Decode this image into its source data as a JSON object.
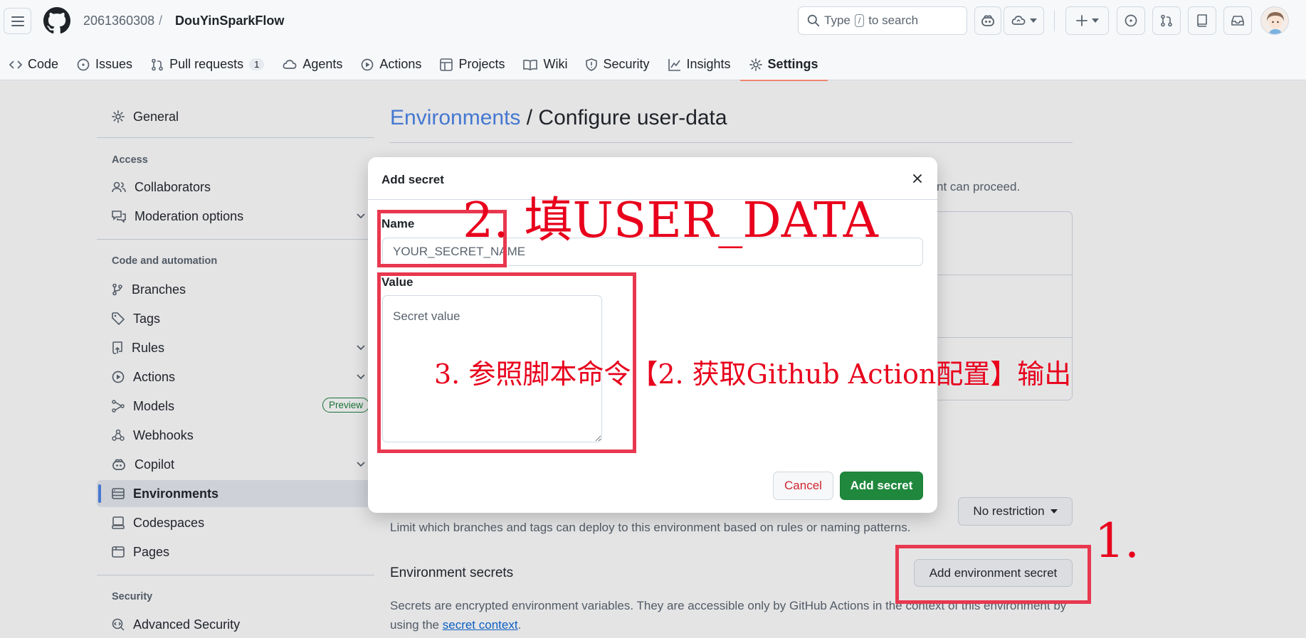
{
  "header": {
    "owner": "2061360308",
    "separator": "/",
    "repo": "DouYinSparkFlow",
    "search": {
      "prefix": "Type",
      "key": "/",
      "suffix": "to search"
    }
  },
  "tabs": [
    {
      "label": "Code",
      "icon": "code-icon"
    },
    {
      "label": "Issues",
      "icon": "issue-icon"
    },
    {
      "label": "Pull requests",
      "icon": "pull-request-icon",
      "count": "1"
    },
    {
      "label": "Agents",
      "icon": "agent-icon"
    },
    {
      "label": "Actions",
      "icon": "play-icon"
    },
    {
      "label": "Projects",
      "icon": "table-icon"
    },
    {
      "label": "Wiki",
      "icon": "book-icon"
    },
    {
      "label": "Security",
      "icon": "shield-icon"
    },
    {
      "label": "Insights",
      "icon": "graph-icon"
    },
    {
      "label": "Settings",
      "icon": "gear-icon",
      "active": true
    }
  ],
  "sidebar": {
    "general": "General",
    "access_heading": "Access",
    "collaborators": "Collaborators",
    "moderation": "Moderation options",
    "code_heading": "Code and automation",
    "branches": "Branches",
    "tags": "Tags",
    "rules": "Rules",
    "actions": "Actions",
    "models": "Models",
    "preview_badge": "Preview",
    "webhooks": "Webhooks",
    "copilot": "Copilot",
    "environments": "Environments",
    "codespaces": "Codespaces",
    "pages": "Pages",
    "security_heading": "Security",
    "advanced_security": "Advanced Security"
  },
  "main": {
    "title_link": "Environments",
    "title_rest": " / Configure user-data",
    "bg_fragment": "nt can proceed.",
    "no_restriction": "No restriction",
    "branches_hint": "Limit which branches and tags can deploy to this environment based on rules or naming patterns.",
    "secrets_heading": "Environment secrets",
    "add_env_secret": "Add environment secret",
    "secrets_desc": "Secrets are encrypted environment variables. They are accessible only by GitHub Actions in the context of this environment by using the ",
    "secret_context_link": "secret context",
    "secrets_desc_end": "."
  },
  "modal": {
    "title": "Add secret",
    "name_label": "Name",
    "name_placeholder": "YOUR_SECRET_NAME",
    "value_label": "Value",
    "value_placeholder": "Secret value",
    "cancel": "Cancel",
    "submit": "Add secret"
  },
  "annotations": {
    "step1": "1.",
    "step2": "2. 填USER_DATA",
    "step3": "3. 参照脚本命令【2. 获取Github Action配置】输出"
  }
}
